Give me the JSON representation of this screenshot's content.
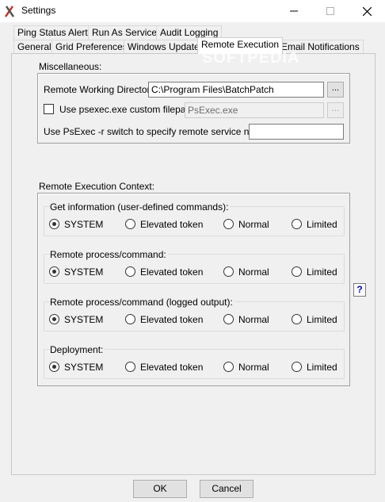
{
  "window": {
    "title": "Settings"
  },
  "watermark": "SOFTPEDIA",
  "tabs_row1": [
    "Ping Status Alerts",
    "Run As Service",
    "Audit Logging"
  ],
  "tabs_row2": [
    "General",
    "Grid Preferences",
    "Windows Update",
    "Remote Execution",
    "Email Notifications"
  ],
  "active_tab": "Remote Execution",
  "misc": {
    "title": "Miscellaneous:",
    "remote_dir_label": "Remote Working Directory:",
    "remote_dir_value": "C:\\Program Files\\BatchPatch",
    "browse_label": "...",
    "psexec_check_label": "Use psexec.exe custom filepath:",
    "psexec_checked": false,
    "psexec_value": "PsExec.exe",
    "service_name_label": "Use PsExec -r switch to specify remote service name:",
    "service_name_value": ""
  },
  "context": {
    "title": "Remote Execution Context:",
    "options": [
      "SYSTEM",
      "Elevated token",
      "Normal",
      "Limited"
    ],
    "groups": [
      {
        "title": "Get information (user-defined commands):",
        "selected": "SYSTEM"
      },
      {
        "title": "Remote process/command:",
        "selected": "SYSTEM"
      },
      {
        "title": "Remote process/command (logged output):",
        "selected": "SYSTEM"
      },
      {
        "title": "Deployment:",
        "selected": "SYSTEM"
      }
    ]
  },
  "help_label": "?",
  "buttons": {
    "ok": "OK",
    "cancel": "Cancel"
  }
}
